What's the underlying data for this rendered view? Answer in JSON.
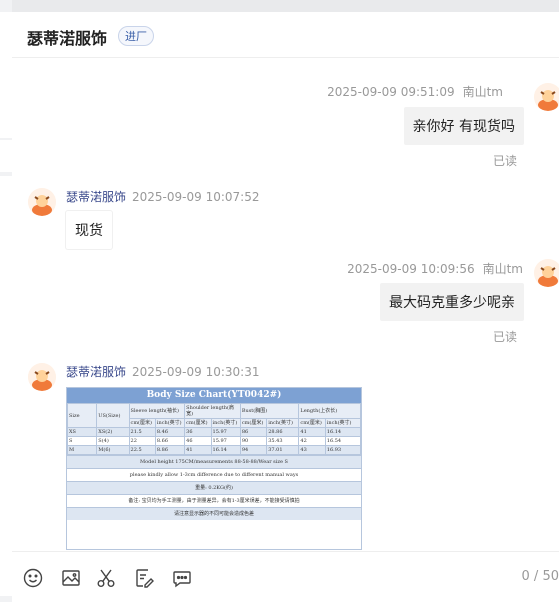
{
  "header": {
    "shop_name": "瑟蒂渃服饰",
    "badge": "进厂"
  },
  "messages": [
    {
      "side": "right",
      "time": "2025-09-09 09:51:09",
      "name": "南山tm",
      "text": "亲你好 有现货吗",
      "status": "已读"
    },
    {
      "side": "left",
      "nick": "瑟蒂渃服饰",
      "time": "2025-09-09 10:07:52",
      "text": "现货"
    },
    {
      "side": "right",
      "time": "2025-09-09 10:09:56",
      "name": "南山tm",
      "text": "最大码克重多少呢亲",
      "status": "已读"
    },
    {
      "side": "left",
      "nick": "瑟蒂渃服饰",
      "time": "2025-09-09 10:30:31"
    }
  ],
  "size_chart": {
    "title": "Body Size Chart(YT0042#)",
    "headers": [
      "Size",
      "US(Size)",
      "Sleeve length(袖长)",
      "",
      "Shoulder length(肩宽)",
      "",
      "Bust(胸围)",
      "",
      "Length(上衣长)",
      ""
    ],
    "subheaders": [
      "",
      "",
      "cm(厘米)",
      "inch(英寸)",
      "cm(厘米)",
      "inch(英寸)",
      "cm(厘米)",
      "inch(英寸)",
      "cm(厘米)",
      "inch(英寸)"
    ],
    "rows": [
      [
        "XS",
        "XS(2)",
        "21.5",
        "8.46",
        "36",
        "15.97",
        "86",
        "28.86",
        "41",
        "16.14"
      ],
      [
        "S",
        "S(4)",
        "22",
        "8.66",
        "46",
        "15.97",
        "90",
        "35.43",
        "42",
        "16.54"
      ],
      [
        "M",
        "M(6)",
        "22.5",
        "8.86",
        "41",
        "16.14",
        "94",
        "37.01",
        "43",
        "16.93"
      ]
    ],
    "notes": [
      "Model height 175CM/measurements 88-58-88/Wear size S",
      "please kindly allow 1-3cm difference due to different manual ways",
      "重量: 0.2KG(约)",
      "备注: 宝贝均为手工测量，由于测量差异，会有1-3厘米误差，不能接受请慎拍",
      "请注意显示器的不同可能会造成色差"
    ]
  },
  "toolbar": {
    "icons": [
      "emoji-icon",
      "image-icon",
      "scissors-icon",
      "quick-reply-icon",
      "chat-more-icon"
    ],
    "counter": "0 / 50"
  }
}
